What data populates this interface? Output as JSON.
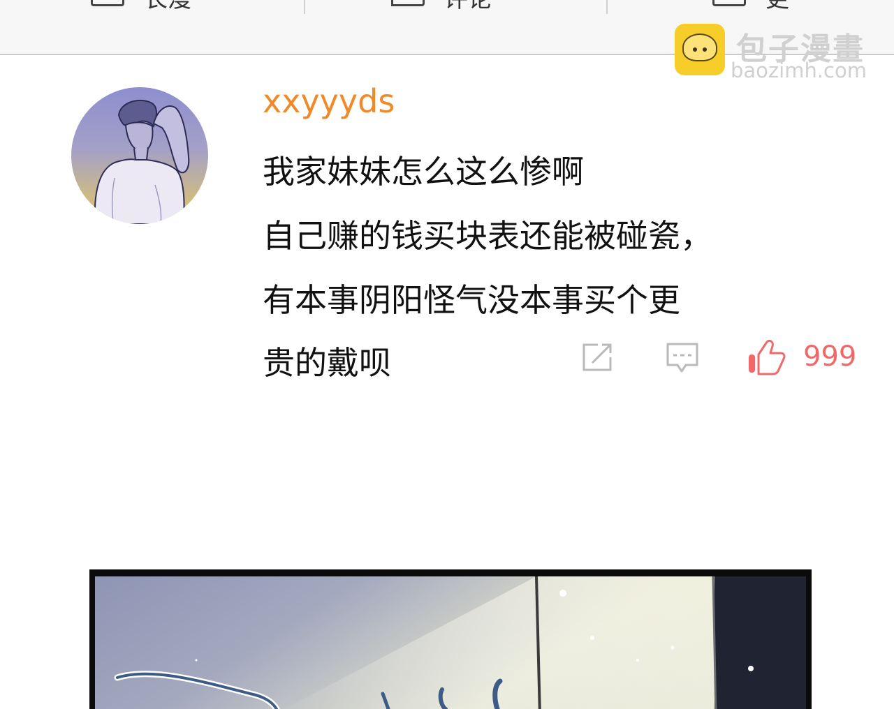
{
  "top_bar": {
    "tabs": [
      {
        "label": "长漫"
      },
      {
        "label": "评论"
      },
      {
        "label": "更"
      }
    ]
  },
  "watermark": {
    "title": "包子漫畫",
    "url": "baozimh.com"
  },
  "comment": {
    "username": "xxyyyds",
    "lines": [
      "我家妹妹怎么这么惨啊",
      "自己赚的钱买块表还能被碰瓷，",
      "有本事阴阳怪气没本事买个更",
      "贵的戴呗"
    ],
    "like_count": "999"
  },
  "colors": {
    "username": "#f08a28",
    "like": "#f06868",
    "icon_gray": "#b9b9b9"
  },
  "icons": {
    "share": "share-icon",
    "reply": "reply-icon",
    "like": "thumbs-up-icon"
  }
}
